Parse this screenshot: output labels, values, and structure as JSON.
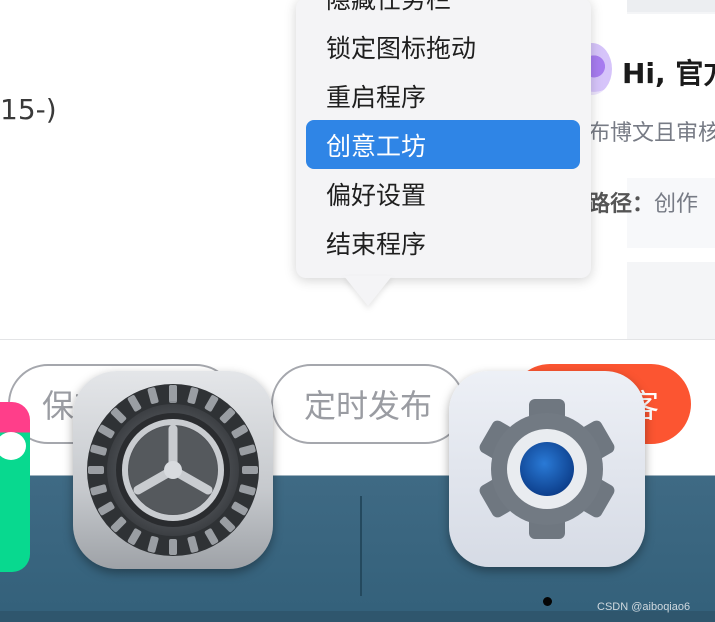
{
  "background_page": {
    "left_partial_text": "15-)",
    "greeting": "Hi, 官方",
    "description": "布博文且审核",
    "path_label": "路径",
    "path_value": "创作"
  },
  "action_bar": {
    "save_label": "保存草稿",
    "schedule_label": "定时发布",
    "publish_label": "发布博客",
    "publish_color": "#fc5531"
  },
  "context_menu": {
    "items": [
      {
        "label": "隐藏任务栏"
      },
      {
        "label": "锁定图标拖动"
      },
      {
        "label": "重启程序"
      },
      {
        "label": "创意工坊",
        "selected": true
      },
      {
        "label": "偏好设置"
      },
      {
        "label": "结束程序"
      }
    ],
    "selected_color": "#2f85e6"
  },
  "dock": {
    "apps": [
      {
        "icon": "colorful-app-icon"
      },
      {
        "icon": "system-preferences-gear-icon"
      },
      {
        "icon": "windows-settings-gear-icon",
        "running": true
      }
    ]
  },
  "watermark": "CSDN @aiboqiao6"
}
